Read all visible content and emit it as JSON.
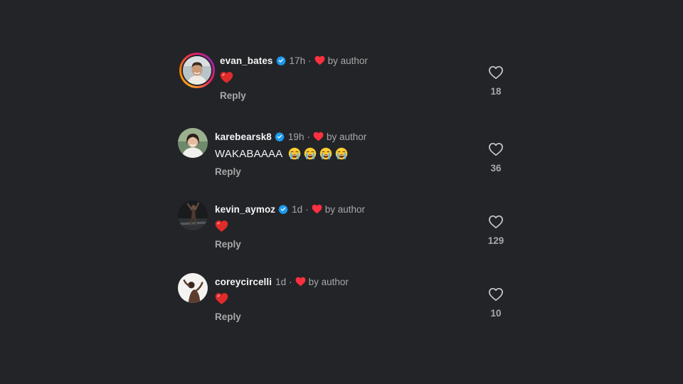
{
  "comments": [
    {
      "username": "evan_bates",
      "verified": true,
      "time": "17h",
      "liked_by_author": "by author",
      "text": "",
      "emoji": "red-heart",
      "reply_label": "Reply",
      "like_count": "18",
      "story_ring": true
    },
    {
      "username": "karebearsk8",
      "verified": true,
      "time": "19h",
      "liked_by_author": "by author",
      "text": "WAKABAAAA",
      "emoji": "loudly-crying-face x4",
      "reply_label": "Reply",
      "like_count": "36",
      "story_ring": false
    },
    {
      "username": "kevin_aymoz",
      "verified": true,
      "time": "1d",
      "liked_by_author": "by author",
      "text": "",
      "emoji": "red-heart",
      "reply_label": "Reply",
      "like_count": "129",
      "story_ring": false
    },
    {
      "username": "coreycircelli",
      "verified": false,
      "time": "1d",
      "liked_by_author": "by author",
      "text": "",
      "emoji": "red-heart",
      "reply_label": "Reply",
      "like_count": "10",
      "story_ring": false
    }
  ],
  "separator": "·",
  "colors": {
    "background": "#232428",
    "verified_badge": "#1d9bf0",
    "author_heart": "#ff3040",
    "secondary_text": "#a8a8a8"
  }
}
